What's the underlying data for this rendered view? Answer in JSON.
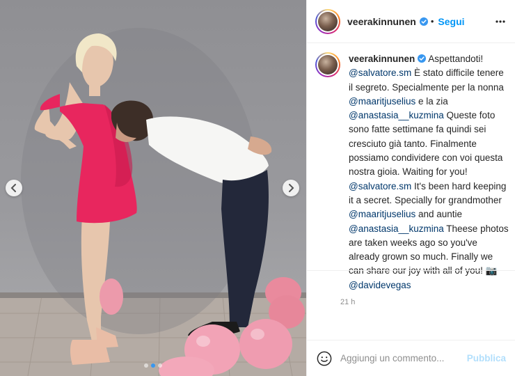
{
  "post": {
    "username": "veerakinnunen",
    "verified": true,
    "separator": "•",
    "follow_label": "Segui",
    "more_icon": "more-horizontal-icon",
    "carousel": {
      "slides": 3,
      "active_slide": 1,
      "prev_icon": "chevron-left-icon",
      "next_icon": "chevron-right-icon"
    }
  },
  "caption": {
    "username": "veerakinnunen",
    "parts": [
      " Aspettandoti! ",
      "@salvatore.sm",
      " È stato difficile tenere il segreto. Specialmente per la nonna ",
      "@maaritjuselius",
      " e la zia ",
      "@anastasia__kuzmina",
      " Queste foto sono fatte settimane fa quindi sei cresciuto già tanto. Finalmente possiamo condividere con voi questa nostra gioia. Waiting for you! ",
      "@salvatore.sm",
      " It's been hard keeping it a secret. Specially for grandmother ",
      "@maaritjuselius",
      " and auntie ",
      "@anastasia__kuzmina",
      " Theese photos are taken weeks ago so you've already grown so much. Finally we can share our joy with all of you! 📷 ",
      "@davidevegas"
    ],
    "time": "21 h"
  },
  "comment_box": {
    "emoji_icon": "smiley-icon",
    "placeholder": "Aggiungi un commento...",
    "publish_label": "Pubblica"
  },
  "colors": {
    "link": "#00376b",
    "follow": "#0095f6",
    "publish_disabled": "#b2dffc",
    "verified": "#3897f0",
    "dress": "#e8265e"
  }
}
